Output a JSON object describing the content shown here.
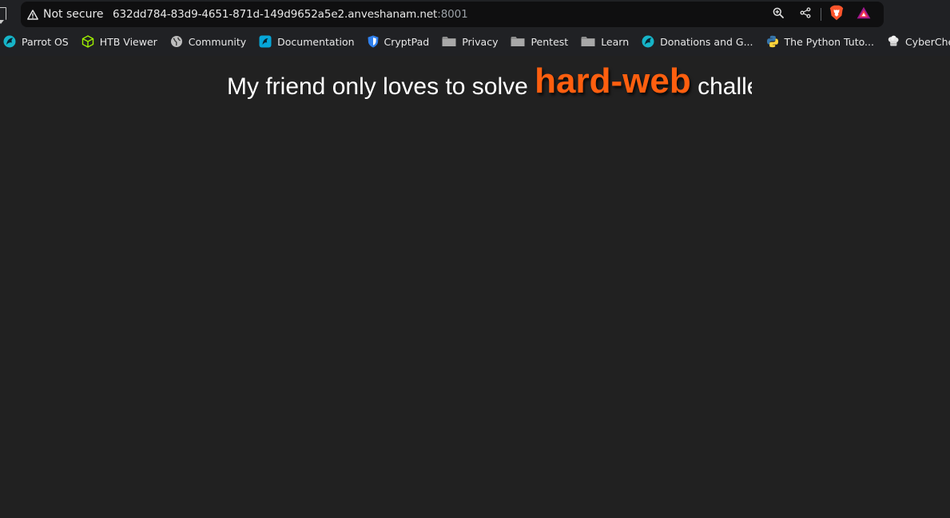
{
  "browser": {
    "security_label": "Not secure",
    "url_host": "632dd784-83d9-4651-871d-149d9652a5e2.anveshanam.net",
    "url_port": ":8001",
    "icons": [
      "warning-icon",
      "zoom-icon",
      "share-icon",
      "brave-shield-icon",
      "brave-rewards-icon"
    ]
  },
  "bookmarks": [
    {
      "label": "Parrot OS",
      "icon": "parrot-icon",
      "color": "#1fb6c9"
    },
    {
      "label": "HTB Viewer",
      "icon": "cube-icon",
      "color": "#9fef00"
    },
    {
      "label": "Community",
      "icon": "globe-icon",
      "color": "#bdbdbd"
    },
    {
      "label": "Documentation",
      "icon": "parrot-doc-icon",
      "color": "#06a6d8"
    },
    {
      "label": "CryptPad",
      "icon": "shield-icon",
      "color": "#2f80ed"
    },
    {
      "label": "Privacy",
      "icon": "folder-icon",
      "color": "#9e9e9e"
    },
    {
      "label": "Pentest",
      "icon": "folder-icon",
      "color": "#9e9e9e"
    },
    {
      "label": "Learn",
      "icon": "folder-icon",
      "color": "#9e9e9e"
    },
    {
      "label": "Donations and G...",
      "icon": "parrot-icon",
      "color": "#1fb6c9"
    },
    {
      "label": "The Python Tuto...",
      "icon": "python-icon",
      "color": "#3776ab"
    },
    {
      "label": "CyberChef",
      "icon": "chef-icon",
      "color": "#e0e0e0"
    }
  ],
  "page": {
    "text_before": "My friend only loves to solve ",
    "highlight": "hard-web",
    "text_after": " challenges",
    "highlight_color": "#ff5f0f",
    "background_color": "#212121"
  }
}
